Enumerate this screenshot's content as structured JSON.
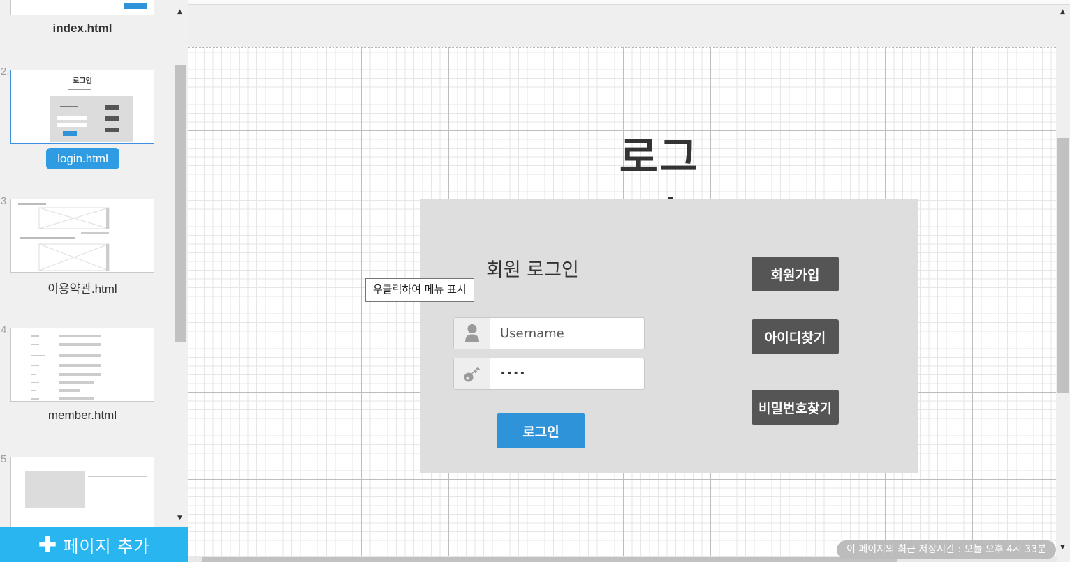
{
  "sidebar": {
    "pages": [
      {
        "number": "",
        "label": "index.html"
      },
      {
        "number": "2.",
        "label": "login.html",
        "thumb_title": "로그인"
      },
      {
        "number": "3.",
        "label": "이용약관.html"
      },
      {
        "number": "4.",
        "label": "member.html"
      },
      {
        "number": "5.",
        "label": ""
      }
    ],
    "add_page_icon": "plus-icon",
    "add_page_label": "페이지 추가"
  },
  "canvas": {
    "heading": "로그인",
    "login_form": {
      "title": "회원 로그인",
      "username_placeholder": "Username",
      "password_value": "••••",
      "login_button": "로그인",
      "user_icon": "user-icon",
      "key_icon": "key-icon"
    },
    "side_buttons": {
      "signup": "회원가입",
      "find_id": "아이디찾기",
      "find_password": "비밀번호찾기"
    }
  },
  "tooltip": "우클릭하여 메뉴 표시",
  "save_status": "이 페이지의 최근 저장시간 : 오늘 오후 4시 33분",
  "colors": {
    "accent_blue": "#2f93d9",
    "add_page_blue": "#29b5ef",
    "dark_button": "#555555",
    "form_panel": "#dedede"
  }
}
